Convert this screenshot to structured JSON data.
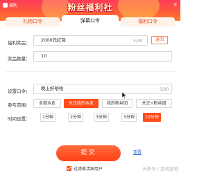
{
  "window": {
    "title": "福利"
  },
  "banner": {
    "title": "粉丝福利社"
  },
  "tabs": [
    {
      "label": "礼物口令"
    },
    {
      "label": "弹幕口令"
    },
    {
      "label": "福利口令"
    }
  ],
  "form": {
    "reward": {
      "label": "福利奖品：",
      "value": "2000元红包",
      "counter": "5/30",
      "return_label": "返回"
    },
    "quantity": {
      "label": "奖品数量：",
      "value": "10"
    },
    "command": {
      "label": "设置口令：",
      "value": "晚上好哈哈",
      "counter": "5/20"
    },
    "scope": {
      "label": "参与范围：",
      "options": [
        "全部水友",
        "关注我的水友",
        "我的粉丝团",
        "关注+粉丝团"
      ],
      "selected": "关注我的水友"
    },
    "time": {
      "label": "时间设置：",
      "options": [
        "1分钟",
        "2分钟",
        "3分钟",
        "5分钟",
        "10分钟"
      ],
      "selected": "10分钟"
    }
  },
  "actions": {
    "submit_label": "提交",
    "reset_label": "重置",
    "filter_label": "过滤非活跃用户",
    "filter_checked": true
  },
  "watermark": "头条号 / 游戏圣地",
  "colors": {
    "accent": "#ff4d1a",
    "banner": "#ff3b5a",
    "link": "#3f6fd8"
  }
}
